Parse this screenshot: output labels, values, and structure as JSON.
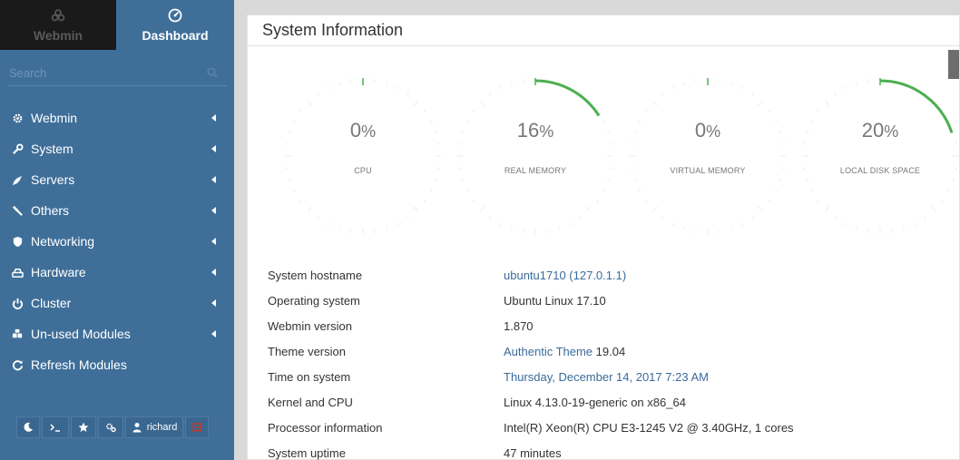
{
  "sidebar": {
    "tabs": [
      {
        "label": "Webmin",
        "icon": "webmin-logo-icon"
      },
      {
        "label": "Dashboard",
        "icon": "dashboard-icon"
      }
    ],
    "search_placeholder": "Search",
    "menu": [
      {
        "label": "Webmin",
        "icon": "gears-icon"
      },
      {
        "label": "System",
        "icon": "wrench-icon"
      },
      {
        "label": "Servers",
        "icon": "rocket-icon"
      },
      {
        "label": "Others",
        "icon": "tools-icon"
      },
      {
        "label": "Networking",
        "icon": "shield-icon"
      },
      {
        "label": "Hardware",
        "icon": "hdd-icon"
      },
      {
        "label": "Cluster",
        "icon": "power-icon"
      },
      {
        "label": "Un-used Modules",
        "icon": "puzzle-icon"
      },
      {
        "label": "Refresh Modules",
        "icon": "refresh-icon"
      }
    ],
    "bottom": {
      "user": "richard"
    }
  },
  "panel": {
    "title": "System Information",
    "gauges": [
      {
        "value": "0",
        "unit": "%",
        "label": "CPU",
        "fraction": 0.0
      },
      {
        "value": "16",
        "unit": "%",
        "label": "REAL MEMORY",
        "fraction": 0.16
      },
      {
        "value": "0",
        "unit": "%",
        "label": "VIRTUAL MEMORY",
        "fraction": 0.0
      },
      {
        "value": "20",
        "unit": "%",
        "label": "LOCAL DISK SPACE",
        "fraction": 0.2
      }
    ],
    "accent_color": "#4caf50",
    "info": [
      {
        "key": "System hostname",
        "value": "ubuntu1710 (127.0.1.1)",
        "link": true
      },
      {
        "key": "Operating system",
        "value": "Ubuntu Linux 17.10",
        "link": false
      },
      {
        "key": "Webmin version",
        "value": "1.870",
        "link": false
      },
      {
        "key": "Theme version",
        "value_link": "Authentic Theme",
        "value_rest": " 19.04",
        "link": "partial"
      },
      {
        "key": "Time on system",
        "value": "Thursday, December 14, 2017 7:23 AM",
        "link": true
      },
      {
        "key": "Kernel and CPU",
        "value": "Linux 4.13.0-19-generic on x86_64",
        "link": false
      },
      {
        "key": "Processor information",
        "value": "Intel(R) Xeon(R) CPU E3-1245 V2 @ 3.40GHz, 1 cores",
        "link": false
      },
      {
        "key": "System uptime",
        "value": "47 minutes",
        "link": false
      }
    ]
  }
}
